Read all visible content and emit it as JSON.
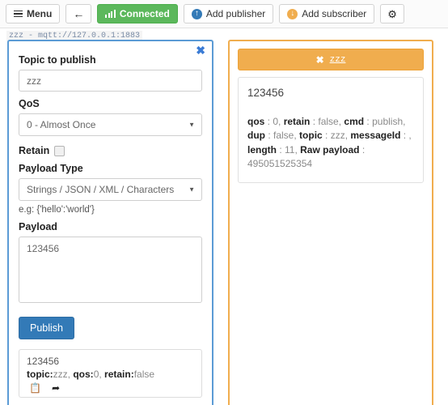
{
  "toolbar": {
    "menu_label": "Menu",
    "menu_icon": "hamburger-icon",
    "back_icon": "arrow-left-icon",
    "connected_label": "Connected",
    "connected_icon": "signal-bars-icon",
    "connected_color": "#5cb85c",
    "add_publisher_label": "Add publisher",
    "add_publisher_icon": "circle-arrow-up-icon",
    "add_publisher_icon_color": "#337ab7",
    "add_subscriber_label": "Add subscriber",
    "add_subscriber_icon": "circle-arrow-down-icon",
    "add_subscriber_icon_color": "#f0ad4e",
    "settings_icon": "gear-icon",
    "settings_glyph": "⚙"
  },
  "connection": {
    "label": "zzz - mqtt://127.0.0.1:1883"
  },
  "publisher": {
    "border_color": "#5b9bd5",
    "close_icon": "close-x-icon",
    "close_glyph": "✖",
    "topic_label": "Topic to publish",
    "topic_value": "zzz",
    "topic_placeholder": "Topic to publish",
    "qos_label": "QoS",
    "qos_value": "0 - Almost Once",
    "qos_caret": "▼",
    "retain_label": "Retain",
    "retain_checked": false,
    "payload_type_label": "Payload Type",
    "payload_type_value": "Strings / JSON / XML / Characters",
    "payload_type_caret": "▼",
    "hint": "e.g: {'hello':'world'}",
    "payload_label": "Payload",
    "payload_value": "123456",
    "payload_placeholder": "Payload",
    "publish_label": "Publish",
    "publish_color": "#337ab7",
    "history": [
      {
        "payload": "123456",
        "meta_parts": [
          {
            "key": "topic:",
            "value": "zzz, "
          },
          {
            "key": "qos:",
            "value": "0, "
          },
          {
            "key": "retain:",
            "value": "false"
          }
        ],
        "copy_icon": "clipboard-icon",
        "copy_glyph": "📋",
        "forward_icon": "share-arrow-icon",
        "forward_glyph": "➦"
      }
    ]
  },
  "subscriber": {
    "border_color": "#f0ad4e",
    "header_topic": "zzz",
    "header_close_icon": "close-x-icon",
    "header_close_glyph": "✖",
    "message": {
      "payload": "123456",
      "detail_parts": [
        {
          "key": "qos",
          "value": " : 0, "
        },
        {
          "key": "retain",
          "value": " : false, "
        },
        {
          "key": "cmd",
          "value": " : publish, "
        },
        {
          "key": "dup",
          "value": " : false, "
        },
        {
          "key": "topic",
          "value": " : zzz, "
        },
        {
          "key": "messageId",
          "value": " : , "
        },
        {
          "key": "length",
          "value": " : 11, "
        },
        {
          "key": "Raw payload",
          "value": " : 495051525354"
        }
      ]
    }
  }
}
